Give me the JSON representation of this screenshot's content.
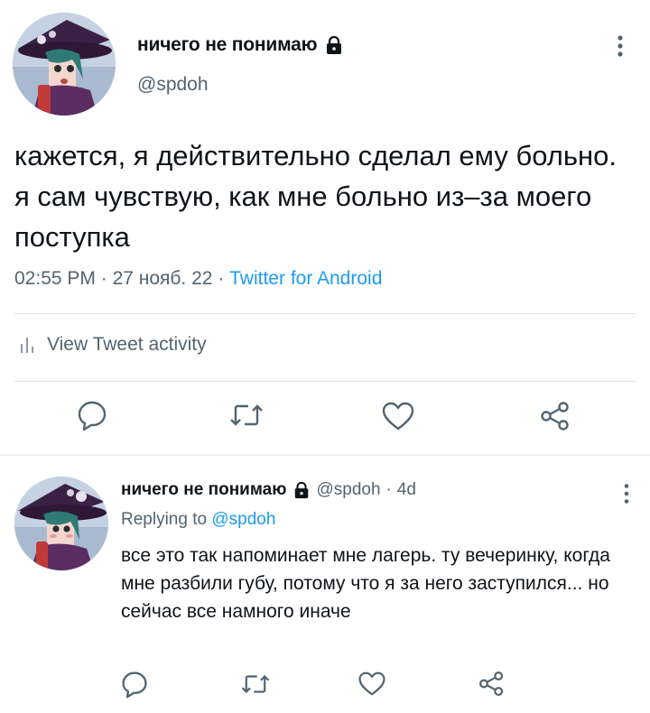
{
  "main_tweet": {
    "display_name": "ничего не понимаю",
    "handle": "@spdoh",
    "text": "кажется, я действительно сделал ему больно. я сам чувствую, как мне больно из–за моего поступка",
    "time": "02:55 PM",
    "date": "27 нояб. 22",
    "source": "Twitter for Android",
    "activity_label": "View Tweet activity",
    "icons": [
      "lock-icon",
      "more-icon",
      "analytics-icon",
      "reply-icon",
      "retweet-icon",
      "like-icon",
      "share-icon"
    ]
  },
  "reply_tweet": {
    "display_name": "ничего не понимаю",
    "handle": "@spdoh",
    "age": "4d",
    "replying_prefix": "Replying to",
    "replying_to": "@spdoh",
    "text": "все это так напоминает мне лагерь. ту вечеринку, когда мне разбили губу, потому что я за него заступился... но сейчас все намного иначе"
  },
  "colors": {
    "text": "#0f1419",
    "secondary": "#536471",
    "accent": "#1d9bf0",
    "divider": "#dfe3e7"
  }
}
